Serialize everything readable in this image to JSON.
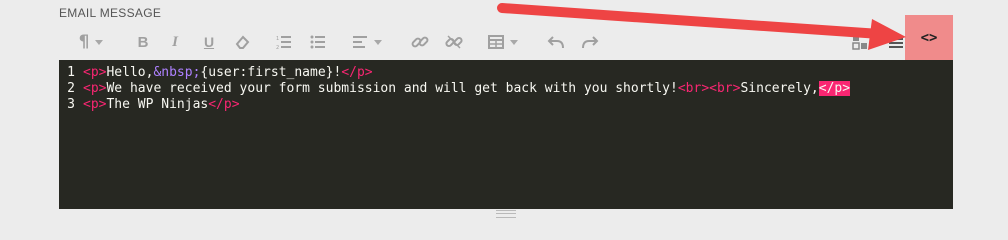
{
  "field": {
    "label": "EMAIL MESSAGE"
  },
  "toolbar": {
    "items": [
      "paragraph-format",
      "bold",
      "italic",
      "underline",
      "clear-format",
      "ordered-list",
      "unordered-list",
      "align",
      "link",
      "unlink",
      "table",
      "undo",
      "redo",
      "media",
      "merge-tags",
      "code-view"
    ],
    "code_view_label": "<>",
    "code_view_active": true,
    "active_color": "#f08b8b"
  },
  "editor": {
    "background": "#272822",
    "lines": [
      {
        "number": "1",
        "segments": [
          {
            "t": "<p>",
            "k": "tag"
          },
          {
            "t": "Hello,",
            "k": "text"
          },
          {
            "t": "&nbsp;",
            "k": "ent"
          },
          {
            "t": "{user:first_name}!",
            "k": "text"
          },
          {
            "t": "</p>",
            "k": "tag"
          }
        ]
      },
      {
        "number": "2",
        "segments": [
          {
            "t": "<p>",
            "k": "tag"
          },
          {
            "t": "We have received your form submission and will get back with you shortly!",
            "k": "text"
          },
          {
            "t": "<br>",
            "k": "tag"
          },
          {
            "t": "<br>",
            "k": "tag"
          },
          {
            "t": "Sincerely,",
            "k": "text"
          },
          {
            "t": "</p>",
            "k": "taghl"
          }
        ]
      },
      {
        "number": "3",
        "segments": [
          {
            "t": "<p>",
            "k": "tag"
          },
          {
            "t": "The WP Ninjas",
            "k": "text"
          },
          {
            "t": "</p>",
            "k": "tag"
          }
        ]
      }
    ]
  },
  "annotation": {
    "arrow_color": "#ee4444"
  }
}
